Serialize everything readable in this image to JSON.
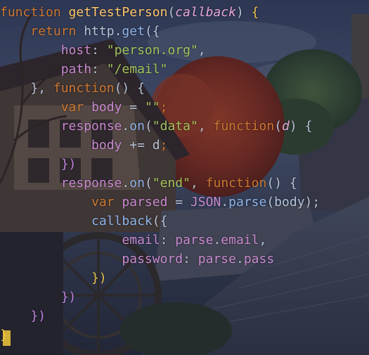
{
  "code_lines": [
    [
      {
        "t": "function ",
        "c": "kw"
      },
      {
        "t": "getTestPerson",
        "c": "fn"
      },
      {
        "t": "(",
        "c": "pl"
      },
      {
        "t": "callback",
        "c": "prm"
      },
      {
        "t": ") ",
        "c": "pl"
      },
      {
        "t": "{",
        "c": "ylw"
      }
    ],
    [
      {
        "t": "    ",
        "c": "pl"
      },
      {
        "t": "return ",
        "c": "kw"
      },
      {
        "t": "http",
        "c": "pl"
      },
      {
        "t": ".",
        "c": "pl"
      },
      {
        "t": "get",
        "c": "mth"
      },
      {
        "t": "({",
        "c": "pl"
      }
    ],
    [
      {
        "t": "        ",
        "c": "pl"
      },
      {
        "t": "host",
        "c": "prop"
      },
      {
        "t": ": ",
        "c": "pl"
      },
      {
        "t": "\"person.org\"",
        "c": "str"
      },
      {
        "t": ",",
        "c": "pl"
      }
    ],
    [
      {
        "t": "        ",
        "c": "pl"
      },
      {
        "t": "path",
        "c": "prop"
      },
      {
        "t": ": ",
        "c": "pl"
      },
      {
        "t": "\"/email\"",
        "c": "str"
      }
    ],
    [
      {
        "t": "    ",
        "c": "pl"
      },
      {
        "t": "}, ",
        "c": "pl"
      },
      {
        "t": "function",
        "c": "kw"
      },
      {
        "t": "() {",
        "c": "pl"
      }
    ],
    [
      {
        "t": "        ",
        "c": "pl"
      },
      {
        "t": "var ",
        "c": "kw"
      },
      {
        "t": "body",
        "c": "prop"
      },
      {
        "t": " = ",
        "c": "pl"
      },
      {
        "t": "\"\"",
        "c": "str"
      },
      {
        "t": ";",
        "c": "kw"
      }
    ],
    [
      {
        "t": "        ",
        "c": "pl"
      },
      {
        "t": "response",
        "c": "prop"
      },
      {
        "t": ".",
        "c": "pl"
      },
      {
        "t": "on",
        "c": "mth"
      },
      {
        "t": "(",
        "c": "pl"
      },
      {
        "t": "\"data\"",
        "c": "str"
      },
      {
        "t": ", ",
        "c": "pl"
      },
      {
        "t": "function",
        "c": "kw"
      },
      {
        "t": "(",
        "c": "pl"
      },
      {
        "t": "d",
        "c": "prm"
      },
      {
        "t": ") {",
        "c": "pl"
      }
    ],
    [
      {
        "t": "            ",
        "c": "pl"
      },
      {
        "t": "body",
        "c": "prop"
      },
      {
        "t": " += ",
        "c": "pl"
      },
      {
        "t": "d",
        "c": "pl"
      },
      {
        "t": ";",
        "c": "kw"
      }
    ],
    [
      {
        "t": "        ",
        "c": "pl"
      },
      {
        "t": "})",
        "c": "pur"
      }
    ],
    [
      {
        "t": "        ",
        "c": "pl"
      },
      {
        "t": "response",
        "c": "prop"
      },
      {
        "t": ".",
        "c": "pl"
      },
      {
        "t": "on",
        "c": "mth"
      },
      {
        "t": "(",
        "c": "pl"
      },
      {
        "t": "\"end\"",
        "c": "str"
      },
      {
        "t": ", ",
        "c": "pl"
      },
      {
        "t": "function",
        "c": "kw"
      },
      {
        "t": "() {",
        "c": "pl"
      }
    ],
    [
      {
        "t": "            ",
        "c": "pl"
      },
      {
        "t": "var ",
        "c": "kw"
      },
      {
        "t": "parsed",
        "c": "prop"
      },
      {
        "t": " = ",
        "c": "pl"
      },
      {
        "t": "JSON",
        "c": "prop"
      },
      {
        "t": ".",
        "c": "pl"
      },
      {
        "t": "parse",
        "c": "mth"
      },
      {
        "t": "(body);",
        "c": "pl"
      }
    ],
    [
      {
        "t": "            ",
        "c": "pl"
      },
      {
        "t": "callback",
        "c": "mth"
      },
      {
        "t": "({",
        "c": "pl"
      }
    ],
    [
      {
        "t": "                ",
        "c": "pl"
      },
      {
        "t": "email",
        "c": "prop"
      },
      {
        "t": ": ",
        "c": "pl"
      },
      {
        "t": "parse",
        "c": "prop"
      },
      {
        "t": ".",
        "c": "pl"
      },
      {
        "t": "email",
        "c": "prop"
      },
      {
        "t": ",",
        "c": "pl"
      }
    ],
    [
      {
        "t": "                ",
        "c": "pl"
      },
      {
        "t": "password",
        "c": "prop"
      },
      {
        "t": ": ",
        "c": "pl"
      },
      {
        "t": "parse",
        "c": "prop"
      },
      {
        "t": ".",
        "c": "pl"
      },
      {
        "t": "pass",
        "c": "prop"
      }
    ],
    [
      {
        "t": "            ",
        "c": "pl"
      },
      {
        "t": "})",
        "c": "ylw"
      }
    ],
    [
      {
        "t": "        ",
        "c": "pl"
      },
      {
        "t": "})",
        "c": "pur"
      }
    ],
    [
      {
        "t": "    ",
        "c": "pl"
      },
      {
        "t": "})",
        "c": "pur"
      }
    ],
    [
      {
        "t": "}",
        "c": "ylw"
      }
    ]
  ],
  "colors": {
    "keyword": "#cc7832",
    "function_name": "#ffc66d",
    "parameter": "#e8a8d8",
    "string": "#a5c25c",
    "property": "#c98ad0",
    "method": "#8fb4e8",
    "brace_highlight": "#e8c24a"
  }
}
